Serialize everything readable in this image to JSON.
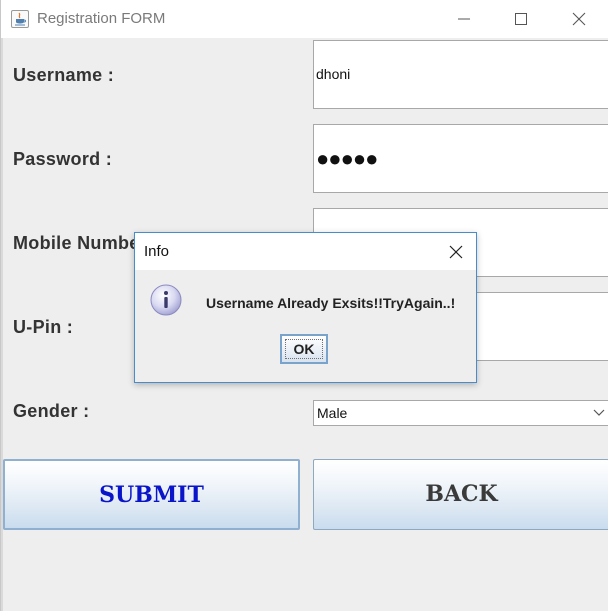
{
  "window": {
    "title": "Registration FORM",
    "app_icon": "java-cup-icon",
    "controls": {
      "minimize": "minimize-icon",
      "maximize": "maximize-icon",
      "close": "close-icon"
    }
  },
  "form": {
    "username": {
      "label": "Username :",
      "value": "dhoni"
    },
    "password": {
      "label": "Password :",
      "value": "●●●●●"
    },
    "mobile": {
      "label": "Mobile Number :",
      "value": ""
    },
    "upin": {
      "label": "U-Pin :",
      "value": ""
    },
    "gender": {
      "label": "Gender :",
      "selected": "Male"
    },
    "submit_label": "SUBMIT",
    "back_label": "BACK"
  },
  "dialog": {
    "title": "Info",
    "icon": "info-icon",
    "message": "Username Already Exsits!!TryAgain..!",
    "ok_label": "OK"
  },
  "colors": {
    "submit_text": "#0a14c8",
    "back_text": "#3a3a3a",
    "dialog_border": "#4a8cc9",
    "window_bg": "#eeeeee"
  }
}
